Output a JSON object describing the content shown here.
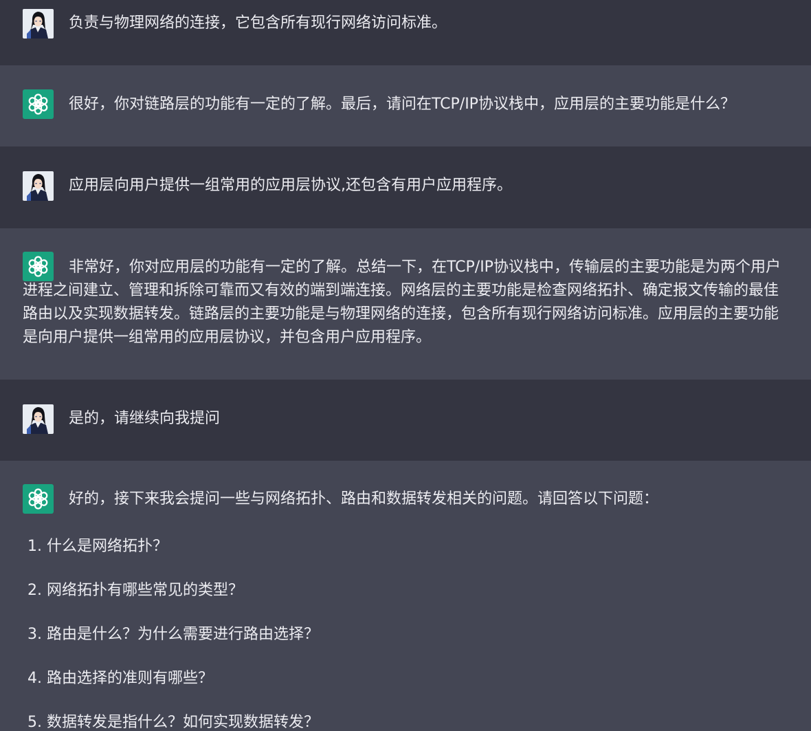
{
  "messages": [
    {
      "role": "user",
      "text": "负责与物理网络的连接，它包含所有现行网络访问标准。"
    },
    {
      "role": "assistant",
      "text": "很好，你对链路层的功能有一定的了解。最后，请问在TCP/IP协议栈中，应用层的主要功能是什么？"
    },
    {
      "role": "user",
      "text": "应用层向用户提供一组常用的应用层协议,还包含有用户应用程序。"
    },
    {
      "role": "assistant",
      "text": "非常好，你对应用层的功能有一定的了解。总结一下，在TCP/IP协议栈中，传输层的主要功能是为两个用户进程之间建立、管理和拆除可靠而又有效的端到端连接。网络层的主要功能是检查网络拓扑、确定报文传输的最佳路由以及实现数据转发。链路层的主要功能是与物理网络的连接，包含所有现行网络访问标准。应用层的主要功能是向用户提供一组常用的应用层协议，并包含用户应用程序。"
    },
    {
      "role": "user",
      "text": "是的，请继续向我提问"
    },
    {
      "role": "assistant",
      "text": "好的，接下来我会提问一些与网络拓扑、路由和数据转发相关的问题。请回答以下问题：",
      "list": [
        "1. 什么是网络拓扑？",
        "2. 网络拓扑有哪些常见的类型？",
        "3. 路由是什么？为什么需要进行路由选择？",
        "4. 路由选择的准则有哪些？",
        "5. 数据转发是指什么？如何实现数据转发？"
      ]
    }
  ],
  "colors": {
    "user_bg": "#343541",
    "assistant_bg": "#444654",
    "assistant_avatar_bg": "#19a37f",
    "text": "#ececf1"
  },
  "icons": {
    "user_avatar": "anime-character-avatar",
    "assistant_avatar": "openai-logo-icon"
  }
}
